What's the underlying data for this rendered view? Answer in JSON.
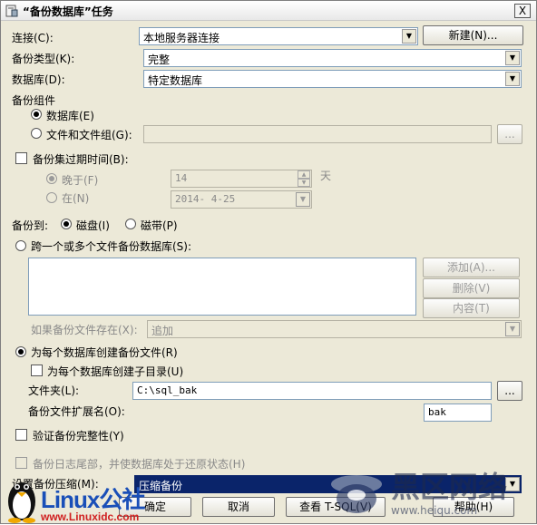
{
  "window": {
    "title": "“备份数据库”任务",
    "close_label": "X"
  },
  "connection": {
    "label": "连接(C):",
    "value": "本地服务器连接",
    "new_button": "新建(N)..."
  },
  "backup_type": {
    "label": "备份类型(K):",
    "value": "完整"
  },
  "database": {
    "label": "数据库(D):",
    "value": "特定数据库"
  },
  "backup_component": {
    "label": "备份组件",
    "option_database": "数据库(E)",
    "option_files": "文件和文件组(G):",
    "files_browse": "..."
  },
  "expiry": {
    "label": "备份集过期时间(B):",
    "after_label": "晚于(F)",
    "after_value": "14",
    "days_unit": "天",
    "on_label": "在(N)",
    "on_value": "2014- 4-25"
  },
  "backup_to": {
    "label": "备份到:",
    "disk": "磁盘(I)",
    "tape": "磁带(P)"
  },
  "multi_file": {
    "label": "跨一个或多个文件备份数据库(S):",
    "add": "添加(A)...",
    "remove": "删除(V)",
    "contents": "内容(T)",
    "if_exists_label": "如果备份文件存在(X):",
    "if_exists_value": "追加"
  },
  "per_db": {
    "label": "为每个数据库创建备份文件(R)",
    "subdir_label": "为每个数据库创建子目录(U)",
    "folder_label": "文件夹(L):",
    "folder_value": "C:\\sql_bak",
    "folder_browse": "...",
    "ext_label": "备份文件扩展名(O):",
    "ext_value": "bak"
  },
  "verify": {
    "label": "验证备份完整性(Y)"
  },
  "tail_log": {
    "label": "备份日志尾部，并使数据库处于还原状态(H)"
  },
  "compression": {
    "label": "设置备份压缩(M):",
    "value": "压缩备份"
  },
  "footer": {
    "ok": "确定",
    "cancel": "取消",
    "view_tsql": "查看 T-SQL(V)",
    "help": "帮助(H)"
  },
  "watermark": {
    "brand": "Linux公社",
    "url": "www.Linuxidc.com",
    "right_text": "黑区网络",
    "right_url": "www.heiqu.com"
  }
}
